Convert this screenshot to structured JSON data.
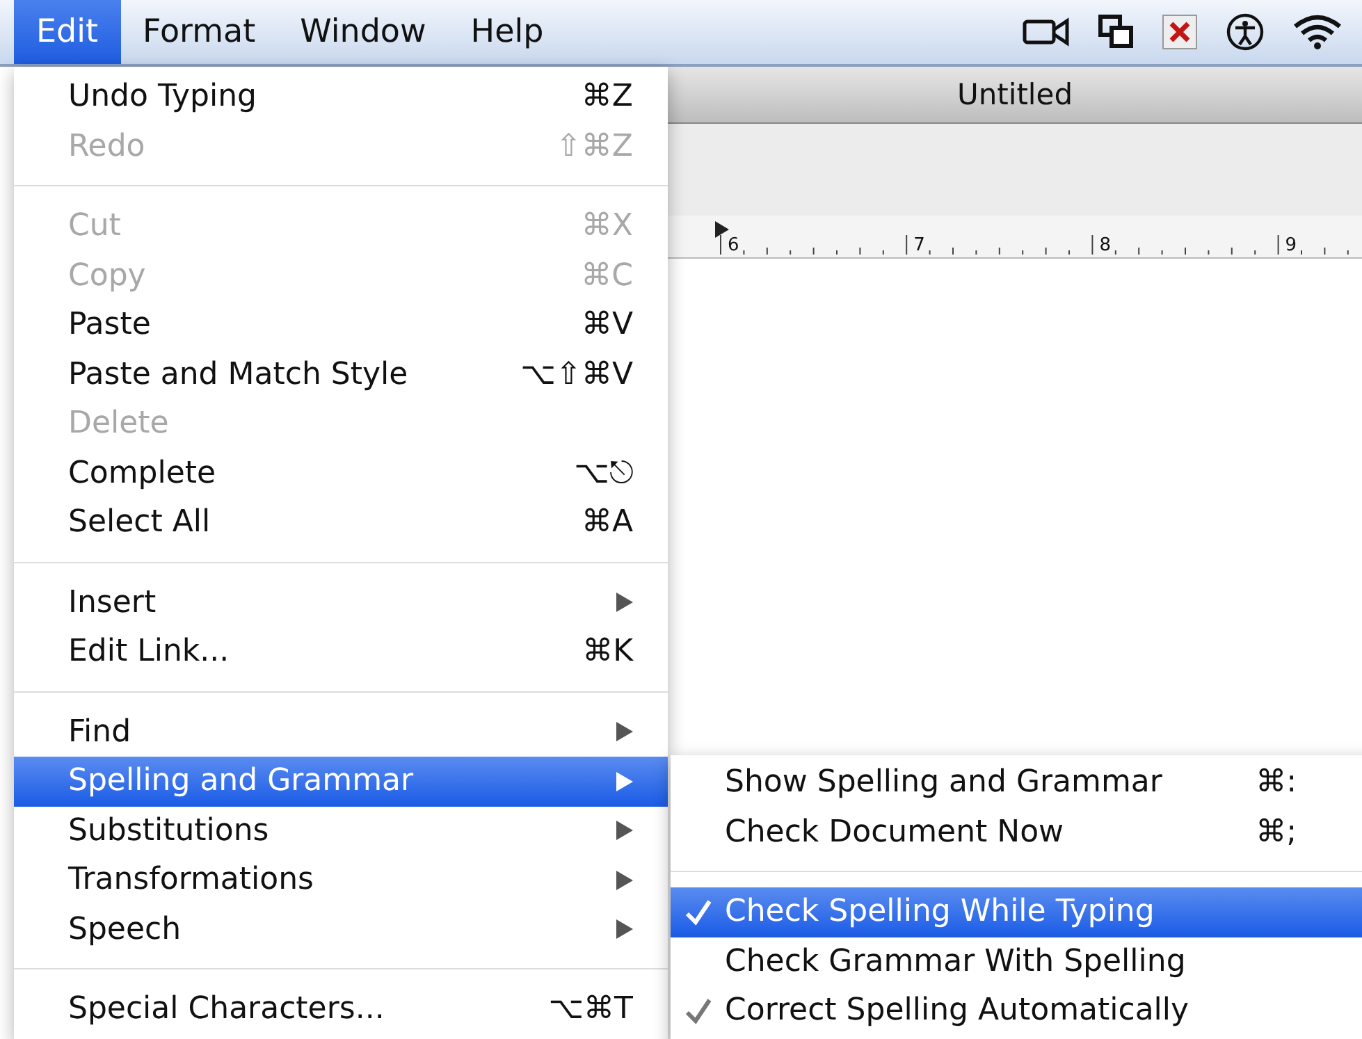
{
  "menu_bar": {
    "menus": [
      {
        "label": "Edit",
        "selected": true
      },
      {
        "label": "Format",
        "selected": false
      },
      {
        "label": "Window",
        "selected": false
      },
      {
        "label": "Help",
        "selected": false
      }
    ]
  },
  "document_window": {
    "title": "Untitled",
    "ruler_labels": [
      "6",
      "7",
      "8",
      "9"
    ]
  },
  "edit_menu": {
    "sections": [
      [
        {
          "label": "Undo Typing",
          "shortcut": "⌘Z",
          "disabled": false,
          "has_submenu": false,
          "selected": false
        },
        {
          "label": "Redo",
          "shortcut": "⇧⌘Z",
          "disabled": true,
          "has_submenu": false,
          "selected": false
        }
      ],
      [
        {
          "label": "Cut",
          "shortcut": "⌘X",
          "disabled": true,
          "has_submenu": false,
          "selected": false
        },
        {
          "label": "Copy",
          "shortcut": "⌘C",
          "disabled": true,
          "has_submenu": false,
          "selected": false
        },
        {
          "label": "Paste",
          "shortcut": "⌘V",
          "disabled": false,
          "has_submenu": false,
          "selected": false
        },
        {
          "label": "Paste and Match Style",
          "shortcut": "⌥⇧⌘V",
          "disabled": false,
          "has_submenu": false,
          "selected": false
        },
        {
          "label": "Delete",
          "disabled": true,
          "has_submenu": false,
          "selected": false
        },
        {
          "label": "Complete",
          "shortcut": "⌥⎋",
          "disabled": false,
          "has_submenu": false,
          "selected": false
        },
        {
          "label": "Select All",
          "shortcut": "⌘A",
          "disabled": false,
          "has_submenu": false,
          "selected": false
        }
      ],
      [
        {
          "label": "Insert",
          "disabled": false,
          "has_submenu": true,
          "selected": false
        },
        {
          "label": "Edit Link...",
          "shortcut": "⌘K",
          "disabled": false,
          "has_submenu": false,
          "selected": false
        }
      ],
      [
        {
          "label": "Find",
          "disabled": false,
          "has_submenu": true,
          "selected": false
        },
        {
          "label": "Spelling and Grammar",
          "disabled": false,
          "has_submenu": true,
          "selected": true
        },
        {
          "label": "Substitutions",
          "disabled": false,
          "has_submenu": true,
          "selected": false
        },
        {
          "label": "Transformations",
          "disabled": false,
          "has_submenu": true,
          "selected": false
        },
        {
          "label": "Speech",
          "disabled": false,
          "has_submenu": true,
          "selected": false
        }
      ],
      [
        {
          "label": "Special Characters...",
          "shortcut": "⌥⌘T",
          "disabled": false,
          "has_submenu": false,
          "selected": false
        }
      ]
    ]
  },
  "spelling_submenu": {
    "sections": [
      [
        {
          "label": "Show Spelling and Grammar",
          "shortcut": "⌘:",
          "checked": false,
          "selected": false
        },
        {
          "label": "Check Document Now",
          "shortcut": "⌘;",
          "checked": false,
          "selected": false
        }
      ],
      [
        {
          "label": "Check Spelling While Typing",
          "checked": true,
          "selected": true
        },
        {
          "label": "Check Grammar With Spelling",
          "checked": false,
          "selected": false
        },
        {
          "label": "Correct Spelling Automatically",
          "checked": true,
          "selected": false
        }
      ]
    ]
  }
}
